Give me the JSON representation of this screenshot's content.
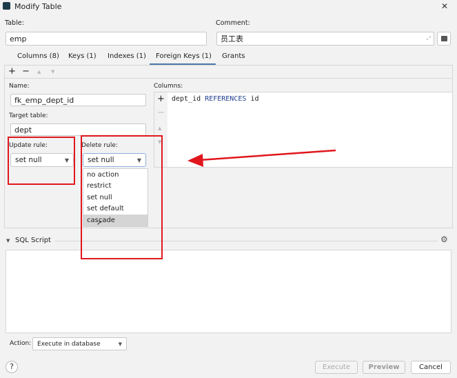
{
  "window": {
    "title": "Modify Table",
    "close": "✕"
  },
  "table": {
    "label": "Table:",
    "value": "emp"
  },
  "comment": {
    "label": "Comment:",
    "value": "员工表"
  },
  "tabs": [
    {
      "label": "Columns (8)"
    },
    {
      "label": "Keys (1)"
    },
    {
      "label": "Indexes (1)"
    },
    {
      "label": "Foreign Keys (1)",
      "active": true
    },
    {
      "label": "Grants"
    }
  ],
  "toolbar": {
    "add": "+",
    "remove": "−",
    "up": "▲",
    "down": "▼"
  },
  "fk": {
    "name_label": "Name:",
    "name": "fk_emp_dept_id",
    "target_label": "Target table:",
    "target": "dept",
    "update_label": "Update rule:",
    "update": "set null",
    "delete_label": "Delete rule:",
    "delete": "set null",
    "delete_options": [
      "no action",
      "restrict",
      "set null",
      "set default",
      "cascade"
    ],
    "hovered_option": "cascade",
    "columns_label": "Columns:",
    "columns_row": {
      "col": "dept_id",
      "kw": "REFERENCES",
      "ref": "id"
    }
  },
  "sql": {
    "label": "SQL Script"
  },
  "action": {
    "label": "Action:",
    "value": "Execute in database"
  },
  "buttons": {
    "help": "?",
    "execute": "Execute",
    "preview": "Preview",
    "cancel": "Cancel"
  },
  "colors": {
    "accent": "#4a79a8",
    "annotation": "#e0161c",
    "hover": "#d5d5d5"
  }
}
